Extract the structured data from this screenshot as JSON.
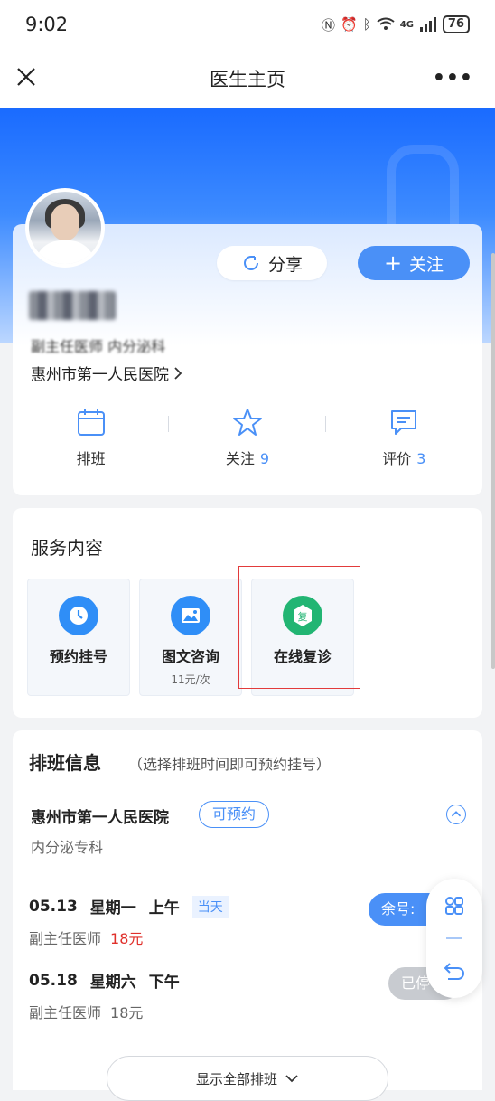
{
  "status": {
    "time": "9:02",
    "signal": "4G",
    "battery": "76"
  },
  "nav": {
    "title": "医生主页"
  },
  "profile": {
    "name": "",
    "title": "副主任医师 内分泌科",
    "hospital": "惠州市第一人民医院",
    "share_label": "分享",
    "follow_label": "关注"
  },
  "stats": [
    {
      "label": "排班",
      "count": ""
    },
    {
      "label": "关注",
      "count": "9"
    },
    {
      "label": "评价",
      "count": "3"
    }
  ],
  "services": {
    "title": "服务内容",
    "items": [
      {
        "name": "预约挂号",
        "sub": "",
        "color": "#2f8ef7"
      },
      {
        "name": "图文咨询",
        "sub": "11元/次",
        "color": "#2f8ef7"
      },
      {
        "name": "在线复诊",
        "sub": "",
        "color": "#22b573",
        "glyph": "复"
      }
    ]
  },
  "schedule": {
    "title": "排班信息",
    "hint": "（选择排班时间即可预约挂号）",
    "hospital": "惠州市第一人民医院",
    "tag": "可预约",
    "dept": "内分泌专科",
    "rows": [
      {
        "date": "05.13",
        "weekday": "星期一",
        "period": "上午",
        "badge": "当天",
        "title": "副主任医师",
        "price": "18元",
        "status": "余号:"
      },
      {
        "date": "05.18",
        "weekday": "星期六",
        "period": "下午",
        "badge": "",
        "title": "副主任医师",
        "price": "18元",
        "status": "已停"
      }
    ],
    "show_all": "显示全部排班"
  }
}
